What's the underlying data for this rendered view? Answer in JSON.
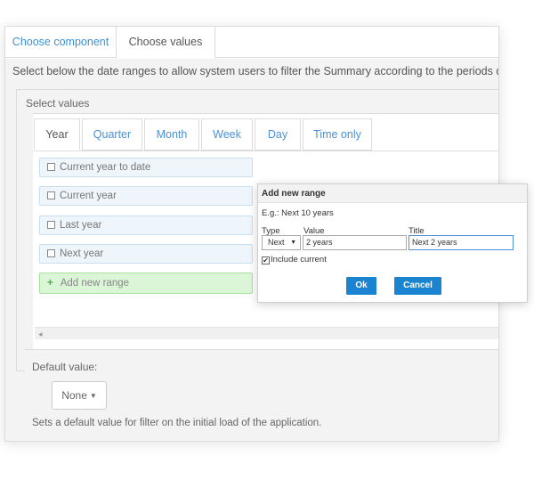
{
  "top_tabs": [
    {
      "label": "Choose component",
      "active": false
    },
    {
      "label": "Choose values",
      "active": true
    }
  ],
  "instruction": "Select below the date ranges to allow system users to filter the Summary according to the periods di",
  "select_values": {
    "title": "Select values",
    "tabs": [
      {
        "label": "Year",
        "active": true
      },
      {
        "label": "Quarter",
        "active": false
      },
      {
        "label": "Month",
        "active": false
      },
      {
        "label": "Week",
        "active": false
      },
      {
        "label": "Day",
        "active": false
      },
      {
        "label": "Time only",
        "active": false
      }
    ],
    "ranges": [
      "Current year to date",
      "Current year",
      "Last year",
      "Next year"
    ],
    "add_new_range": "Add new range",
    "scroll_left": "◂"
  },
  "default_value": {
    "label": "Default value:",
    "button": "None",
    "help": "Sets a default value for filter on the initial load of the application."
  },
  "dialog": {
    "title": "Add new range",
    "example": "E.g.: Next 10 years",
    "type_label": "Type",
    "value_label": "Value",
    "title_label": "Title",
    "type_selected": "Next",
    "value_input": "2 years",
    "title_input": "Next 2 years",
    "include_current": "Include current",
    "include_current_checked": true,
    "ok": "Ok",
    "cancel": "Cancel"
  },
  "icons": {
    "plus": "plus-icon",
    "caret": "caret-down-icon",
    "checkbox": "checkbox-icon"
  },
  "colors": {
    "accent": "#1a84d0",
    "link": "#4a90d9",
    "add_bg": "#daf6d6",
    "range_bg": "#eef5fb"
  }
}
